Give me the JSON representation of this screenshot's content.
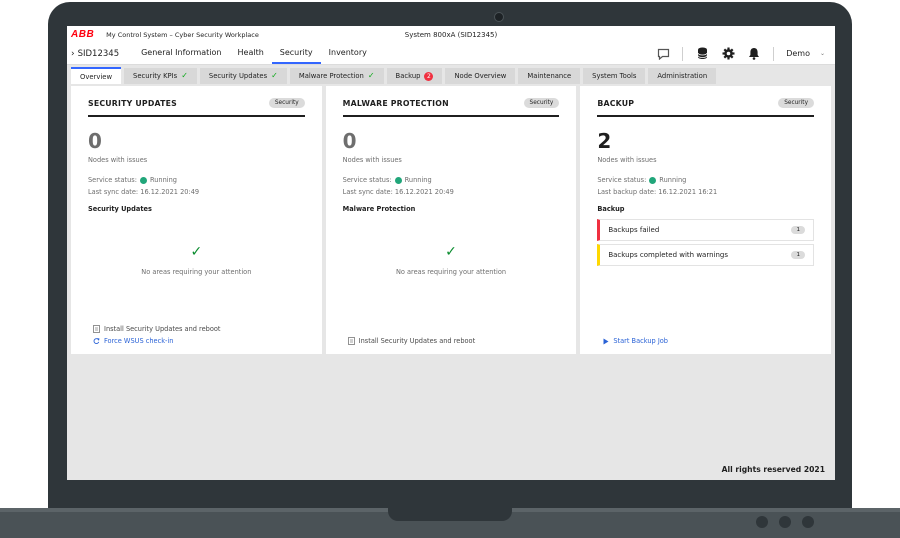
{
  "brand": {
    "logo_text": "ABB",
    "app_title": "My Control System – Cyber Security Workplace"
  },
  "system_title": "System 800xA (SID12345)",
  "nav": {
    "node_id": "SID12345",
    "tabs": [
      {
        "label": "General Information"
      },
      {
        "label": "Health"
      },
      {
        "label": "Security",
        "active": true
      },
      {
        "label": "Inventory"
      }
    ],
    "user": "Demo"
  },
  "subtabs": [
    {
      "label": "Overview",
      "active": true
    },
    {
      "label": "Security KPIs",
      "check": true
    },
    {
      "label": "Security Updates",
      "check": true
    },
    {
      "label": "Malware Protection",
      "check": true
    },
    {
      "label": "Backup",
      "badge": "2"
    },
    {
      "label": "Node Overview"
    },
    {
      "label": "Maintenance"
    },
    {
      "label": "System Tools"
    },
    {
      "label": "Administration"
    }
  ],
  "cards": {
    "security_updates": {
      "title": "SECURITY UPDATES",
      "pill": "Security",
      "count": "0",
      "count_label": "Nodes with issues",
      "status_prefix": "Service status:",
      "status_value": "Running",
      "sync_label": "Last sync date: 16.12.2021 20:49",
      "section": "Security Updates",
      "ok_text": "No areas requiring your attention",
      "action1": "Install Security Updates and reboot",
      "action2": "Force WSUS check-in"
    },
    "malware": {
      "title": "MALWARE PROTECTION",
      "pill": "Security",
      "count": "0",
      "count_label": "Nodes with issues",
      "status_prefix": "Service status:",
      "status_value": "Running",
      "sync_label": "Last sync date: 16.12.2021 20:49",
      "section": "Malware Protection",
      "ok_text": "No areas requiring your attention",
      "action1": "Install Security Updates and reboot"
    },
    "backup": {
      "title": "BACKUP",
      "pill": "Security",
      "count": "2",
      "count_label": "Nodes with issues",
      "status_prefix": "Service status:",
      "status_value": "Running",
      "sync_label": "Last backup date: 16.12.2021 16:21",
      "section": "Backup",
      "items": [
        {
          "label": "Backups failed",
          "count": "1",
          "status_color": "#f03040"
        },
        {
          "label": "Backups completed with warnings",
          "count": "1",
          "status_color": "#ffd800"
        }
      ],
      "action": "Start Backup Job"
    }
  },
  "footer": "All rights reserved 2021",
  "colors": {
    "accent": "#3366ff",
    "brand": "#ff000f",
    "ok": "#21a67a",
    "error": "#f03040",
    "warning": "#ffd800",
    "link": "#2a62d6"
  }
}
